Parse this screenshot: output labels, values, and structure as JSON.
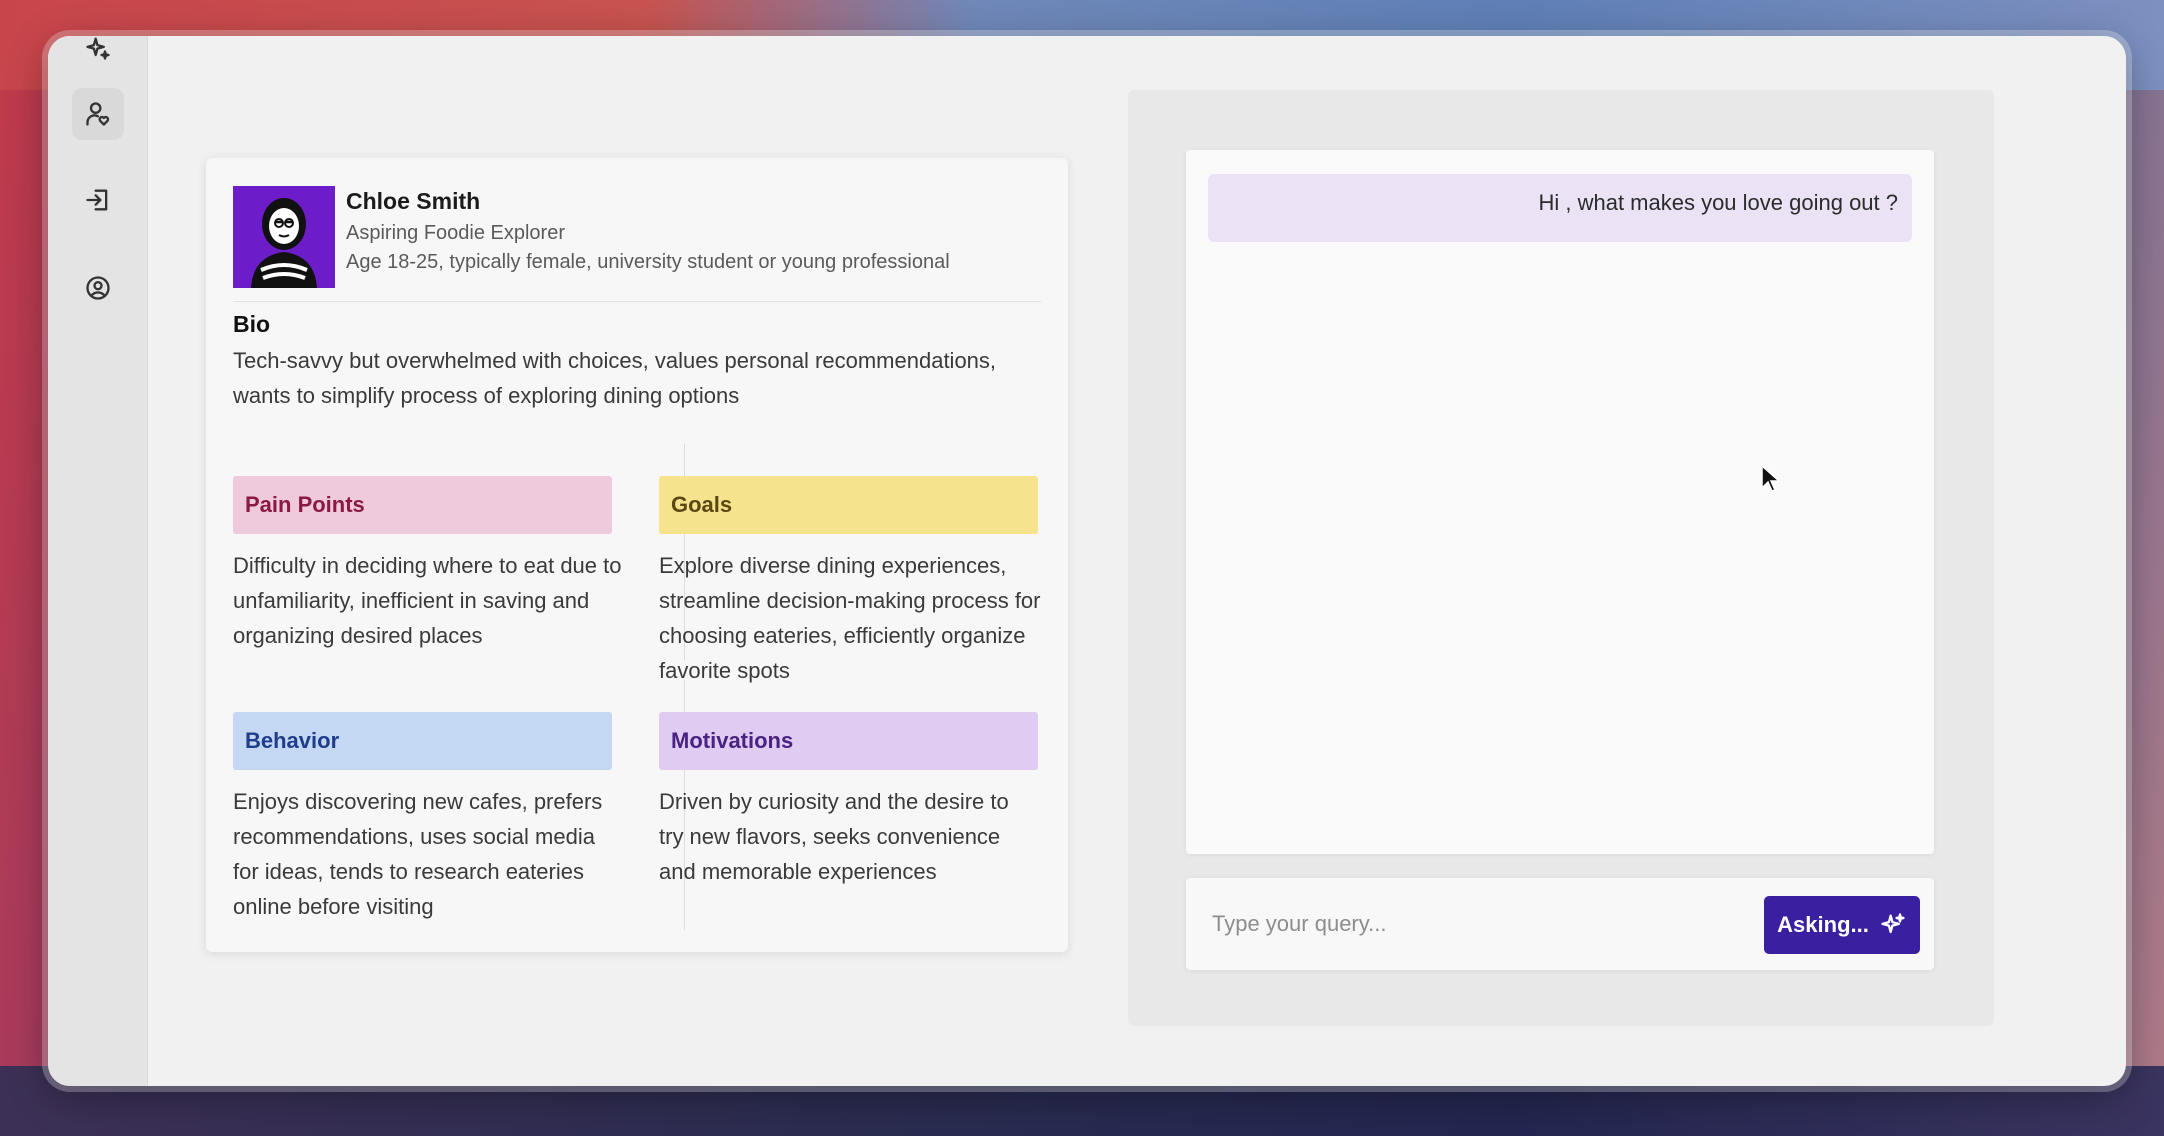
{
  "colors": {
    "pain_points_bg": "#efc9dc",
    "pain_points_fg": "#8a1a44",
    "goals_bg": "#f5e38e",
    "goals_fg": "#5a4a12",
    "behavior_bg": "#c4d7f3",
    "behavior_fg": "#1f3d8a",
    "motivations_bg": "#e0ccf2",
    "motivations_fg": "#4a2284",
    "avatar_bg": "#6c1cc9",
    "ask_button_bg": "#3a1fa0",
    "message_bg": "#ebe2f6"
  },
  "sidebar": {
    "items": [
      {
        "icon": "sparkle-icon"
      },
      {
        "icon": "user-heart-icon",
        "active": true
      },
      {
        "icon": "login-icon"
      },
      {
        "icon": "user-circle-icon"
      }
    ]
  },
  "persona": {
    "name": "Chloe Smith",
    "role": "Aspiring Foodie Explorer",
    "demographics": "Age 18-25, typically female, university student or young professional",
    "bio_heading": "Bio",
    "bio": "Tech-savvy but overwhelmed with choices, values personal recommendations, wants to simplify process of exploring dining options",
    "sections": {
      "pain_points": {
        "title": "Pain Points",
        "text": "Difficulty in deciding where to eat due to unfamiliarity, inefficient in saving and organizing desired places"
      },
      "goals": {
        "title": "Goals",
        "text": "Explore diverse dining experiences, streamline decision-making process for choosing eateries, efficiently organize favorite spots"
      },
      "behavior": {
        "title": "Behavior",
        "text": "Enjoys discovering new cafes, prefers recommendations, uses social media for ideas, tends to research eateries online before visiting"
      },
      "motivations": {
        "title": "Motivations",
        "text": "Driven by curiosity and the desire to try new flavors, seeks convenience and memorable experiences"
      }
    }
  },
  "chat": {
    "messages": [
      {
        "role": "user",
        "text": "Hi , what makes you love going out ?"
      }
    ],
    "input": {
      "placeholder": "Type your query...",
      "value": ""
    },
    "ask_button_label": "Asking..."
  }
}
